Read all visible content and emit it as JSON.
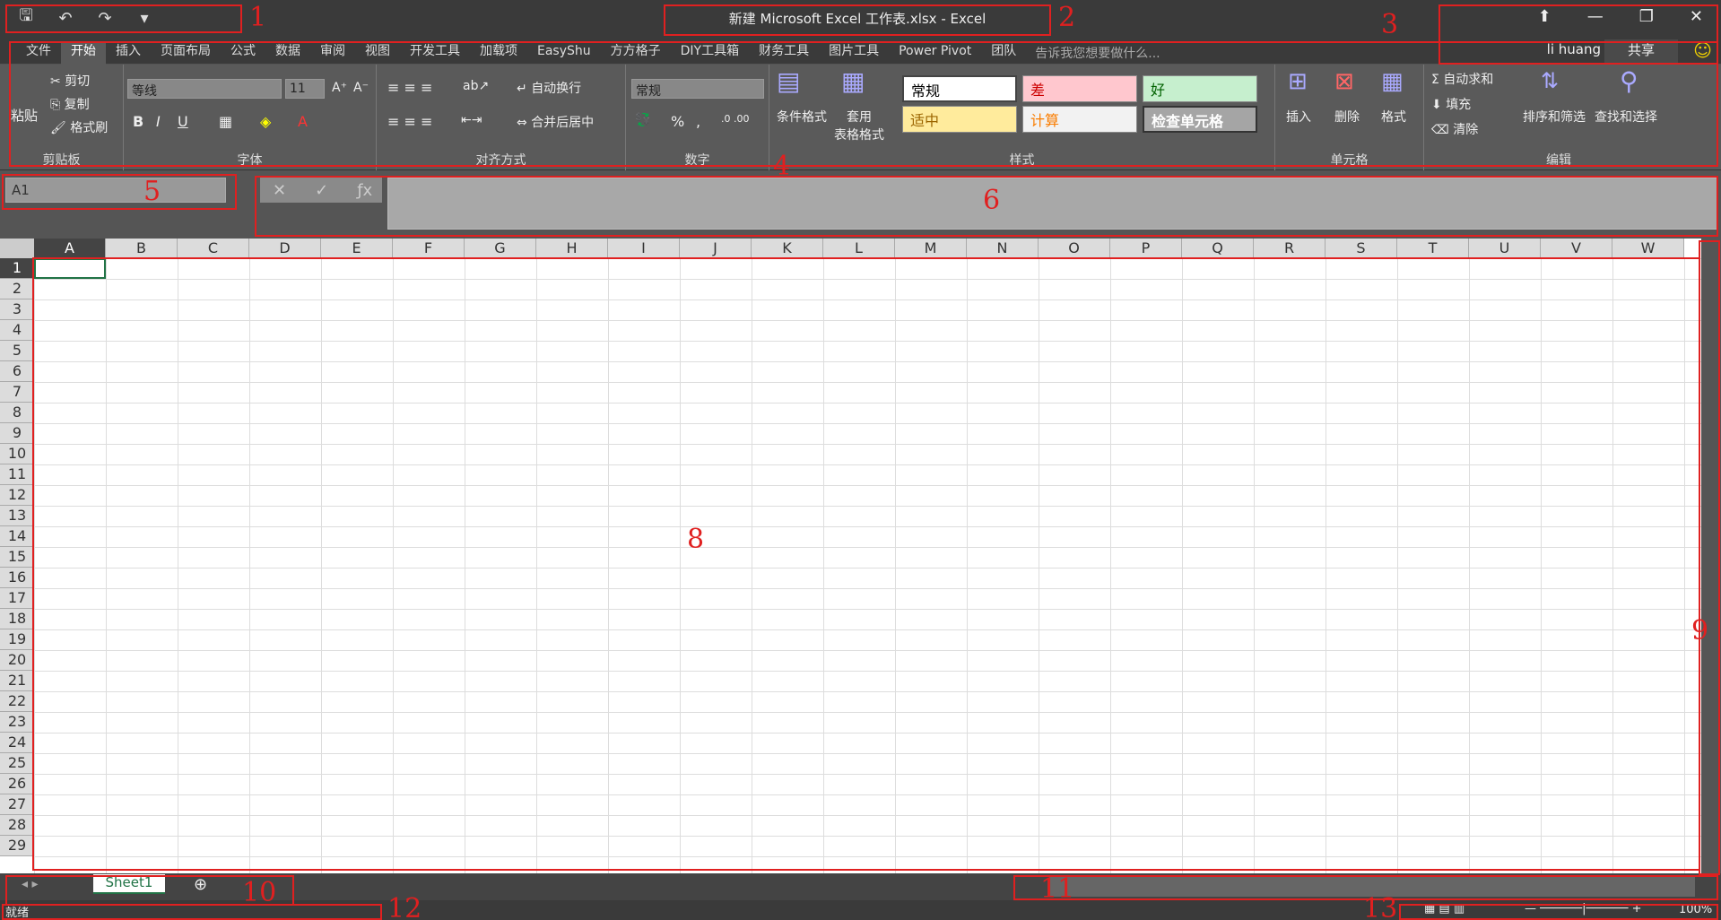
{
  "title": "新建 Microsoft Excel 工作表.xlsx - Excel",
  "qat": {
    "save": "🖫",
    "undo": "↶",
    "redo": "↷",
    "more": "▾"
  },
  "menu": [
    "文件",
    "开始",
    "插入",
    "页面布局",
    "公式",
    "数据",
    "审阅",
    "视图",
    "开发工具",
    "加载项",
    "EasyShu",
    "方方格子",
    "DIY工具箱",
    "财务工具",
    "图片工具",
    "Power Pivot",
    "团队"
  ],
  "tell": "告诉我您想要做什么...",
  "user": "li huang",
  "share": "共享",
  "clipboard": {
    "paste": "粘贴",
    "cut": "剪切",
    "copy": "复制",
    "painter": "格式刷",
    "label": "剪贴板"
  },
  "font": {
    "name": "等线",
    "size": "11",
    "label": "字体"
  },
  "align": {
    "wrap": "自动换行",
    "merge": "合并后居中",
    "label": "对齐方式"
  },
  "number": {
    "format": "常规",
    "label": "数字"
  },
  "styles": {
    "cond": "条件格式",
    "table": "套用\n表格格式",
    "normal": "常规",
    "bad": "差",
    "good": "好",
    "neutral": "适中",
    "calc": "计算",
    "check": "检查单元格",
    "label": "样式"
  },
  "cells": {
    "insert": "插入",
    "delete": "删除",
    "format": "格式",
    "label": "单元格"
  },
  "edit": {
    "autosum": "自动求和",
    "fill": "填充",
    "clear": "清除",
    "sort": "排序和筛选",
    "find": "查找和选择",
    "label": "编辑"
  },
  "namebox": "A1",
  "columns": [
    "A",
    "B",
    "C",
    "D",
    "E",
    "F",
    "G",
    "H",
    "I",
    "J",
    "K",
    "L",
    "M",
    "N",
    "O",
    "P",
    "Q",
    "R",
    "S",
    "T",
    "U",
    "V",
    "W"
  ],
  "rows": [
    "1",
    "2",
    "3",
    "4",
    "5",
    "6",
    "7",
    "8",
    "9",
    "10",
    "11",
    "12",
    "13",
    "14",
    "15",
    "16",
    "17",
    "18",
    "19",
    "20",
    "21",
    "22",
    "23",
    "24",
    "25",
    "26",
    "27",
    "28",
    "29"
  ],
  "sheet": "Sheet1",
  "status": "就绪",
  "zoom": "100%",
  "annotations": [
    "1",
    "2",
    "3",
    "4",
    "5",
    "6",
    "8",
    "9",
    "10",
    "11",
    "12",
    "13"
  ]
}
